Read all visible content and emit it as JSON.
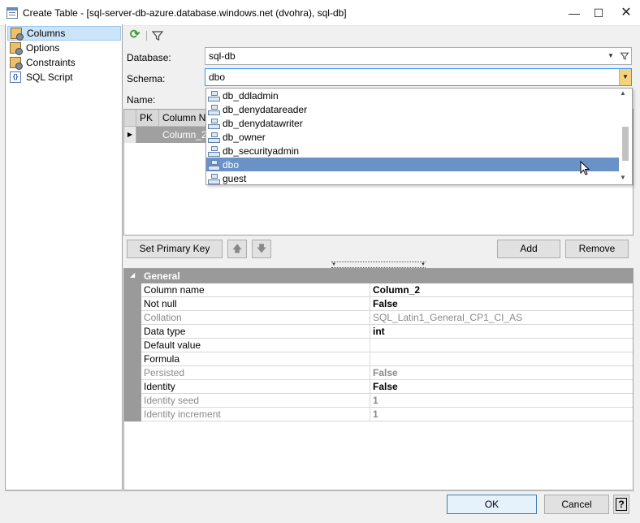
{
  "window": {
    "title": "Create Table - [sql-server-db-azure.database.windows.net (dvohra), sql-db]",
    "minimize": "—",
    "maximize": "☐",
    "close": "✕"
  },
  "nav": {
    "items": [
      {
        "label": "Columns",
        "icon": "table-columns-icon",
        "selected": true
      },
      {
        "label": "Options",
        "icon": "table-options-icon",
        "selected": false
      },
      {
        "label": "Constraints",
        "icon": "table-constraints-icon",
        "selected": false
      },
      {
        "label": "SQL Script",
        "icon": "sql-script-icon",
        "selected": false
      }
    ]
  },
  "form": {
    "database_label": "Database:",
    "database_value": "sql-db",
    "schema_label": "Schema:",
    "schema_value": "dbo",
    "name_label": "Name:"
  },
  "grid": {
    "columns": [
      "PK",
      "Column Name"
    ],
    "rows": [
      {
        "pk": "",
        "column_name": "Column_2"
      }
    ]
  },
  "schema_dropdown": {
    "items": [
      "db_ddladmin",
      "db_denydatareader",
      "db_denydatawriter",
      "db_owner",
      "db_securityadmin",
      "dbo",
      "guest"
    ],
    "selected": "dbo"
  },
  "buttons": {
    "set_primary_key": "Set Primary Key",
    "move_up": "🡅",
    "move_down": "🡇",
    "add": "Add",
    "remove": "Remove",
    "ok": "OK",
    "cancel": "Cancel",
    "help": "?"
  },
  "properties": {
    "section": "General",
    "rows": [
      {
        "name": "Column name",
        "value": "Column_2",
        "bold": true,
        "disabled": false
      },
      {
        "name": "Not null",
        "value": "False",
        "bold": true,
        "disabled": false
      },
      {
        "name": "Collation",
        "value": "SQL_Latin1_General_CP1_CI_AS",
        "bold": false,
        "disabled": true
      },
      {
        "name": "Data type",
        "value": "int",
        "bold": true,
        "disabled": false
      },
      {
        "name": "Default value",
        "value": "",
        "bold": false,
        "disabled": false
      },
      {
        "name": "Formula",
        "value": "",
        "bold": false,
        "disabled": false
      },
      {
        "name": "Persisted",
        "value": "False",
        "bold": true,
        "disabled": true
      },
      {
        "name": "Identity",
        "value": "False",
        "bold": true,
        "disabled": false
      },
      {
        "name": "Identity seed",
        "value": "1",
        "bold": true,
        "disabled": true
      },
      {
        "name": "Identity increment",
        "value": "1",
        "bold": true,
        "disabled": true
      }
    ]
  }
}
